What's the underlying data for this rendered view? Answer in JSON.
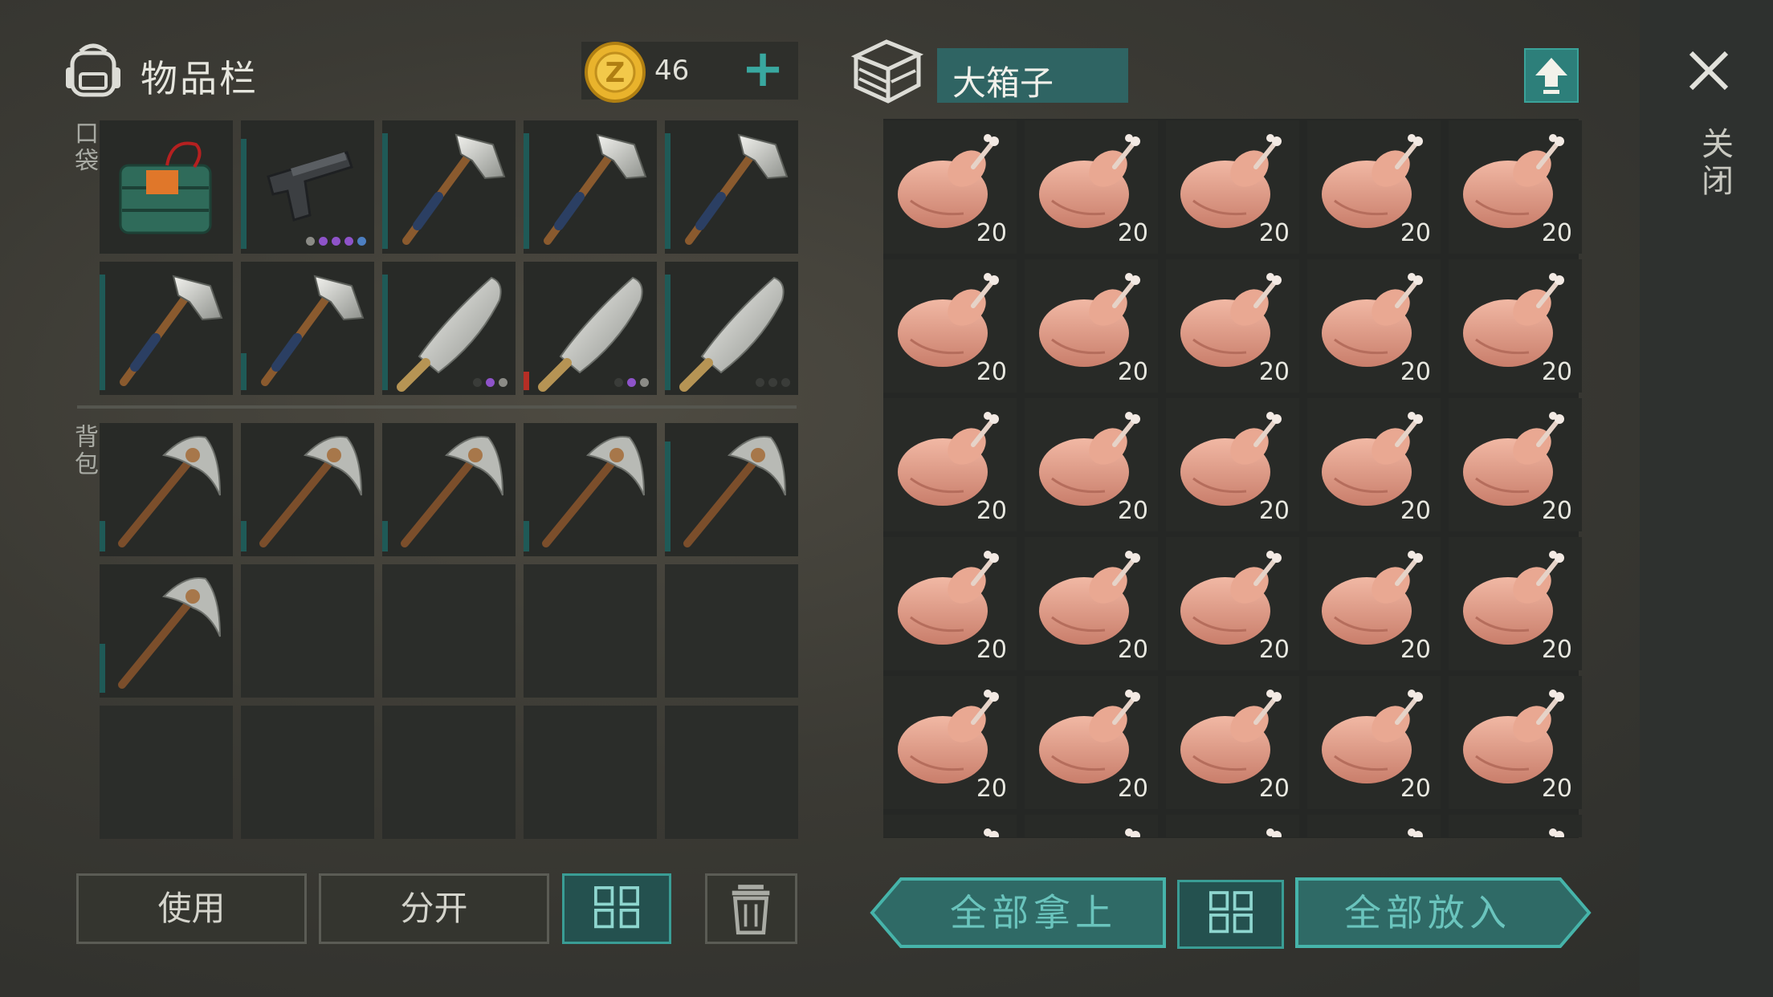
{
  "inventory": {
    "title": "物品栏",
    "coins": "46",
    "pocket_label": "口袋",
    "backpack_label": "背包",
    "pocket_slots": [
      {
        "item": "c4-explosive-icon",
        "bar": 0,
        "dots": []
      },
      {
        "item": "pistol-icon",
        "bar": 0.9,
        "dots": [
          "g",
          "p",
          "p",
          "p",
          "b"
        ]
      },
      {
        "item": "axe-icon",
        "bar": 0.95,
        "dots": []
      },
      {
        "item": "axe-icon",
        "bar": 0.95,
        "dots": []
      },
      {
        "item": "axe-icon",
        "bar": 0.95,
        "dots": []
      },
      {
        "item": "axe-icon",
        "bar": 0.95,
        "dots": []
      },
      {
        "item": "axe-icon",
        "bar": 0.3,
        "dots": []
      },
      {
        "item": "machete-icon",
        "bar": 0.95,
        "dots": [
          "n",
          "p",
          "g"
        ]
      },
      {
        "item": "machete-icon",
        "bar": 0.15,
        "bar_color": "red",
        "dots": [
          "n",
          "p",
          "g"
        ]
      },
      {
        "item": "machete-icon",
        "bar": 0.95,
        "dots": [
          "n",
          "n",
          "n"
        ]
      }
    ],
    "backpack_slots": [
      {
        "item": "pickaxe-icon",
        "bar": 0.25
      },
      {
        "item": "pickaxe-icon",
        "bar": 0.25
      },
      {
        "item": "pickaxe-icon",
        "bar": 0.25
      },
      {
        "item": "pickaxe-icon",
        "bar": 0.25
      },
      {
        "item": "pickaxe-icon",
        "bar": 0.9
      },
      {
        "item": "pickaxe-icon",
        "bar": 0.4
      },
      {
        "item": null
      },
      {
        "item": null
      },
      {
        "item": null
      },
      {
        "item": null
      },
      {
        "item": null
      },
      {
        "item": null
      },
      {
        "item": null
      },
      {
        "item": null
      },
      {
        "item": null
      }
    ]
  },
  "container": {
    "title": "大箱子",
    "item": "raw-chicken-icon",
    "quantity": "20",
    "full_rows": 5,
    "columns": 5,
    "partial_row_visible": true
  },
  "buttons": {
    "use": "使用",
    "split": "分开",
    "take_all": "全部拿上",
    "put_all": "全部放入",
    "close": "关闭"
  },
  "colors": {
    "accent": "#2f6463",
    "accent_text": "#6ac4bd",
    "durability": "#1f5a57",
    "low_durability": "#b62e25",
    "coin": "#e9b32c"
  }
}
